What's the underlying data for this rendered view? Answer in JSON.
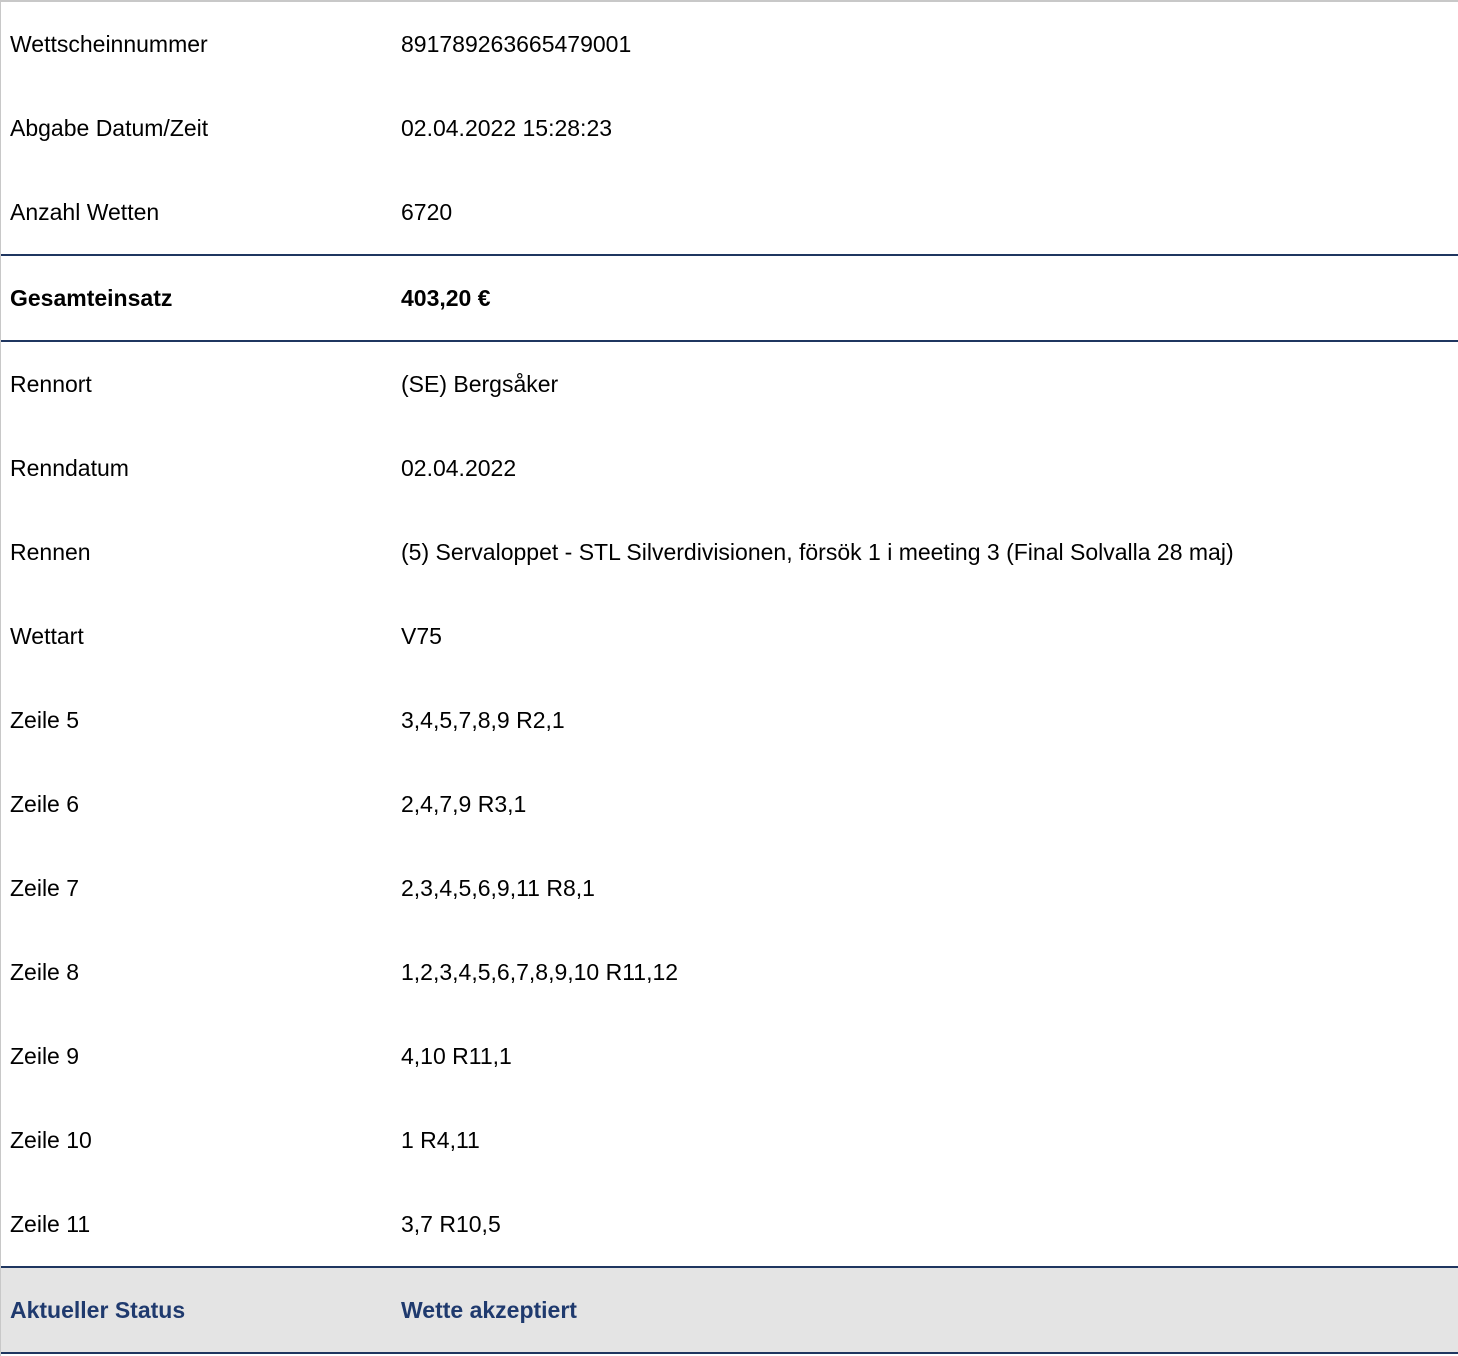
{
  "colors": {
    "separator": "#1f3660",
    "status_text": "#1f3a6e",
    "status_background": "#e4e4e4"
  },
  "info_rows": [
    {
      "label": "Wettscheinnummer",
      "value": "891789263665479001"
    },
    {
      "label": "Abgabe Datum/Zeit",
      "value": "02.04.2022 15:28:23"
    },
    {
      "label": "Anzahl Wetten",
      "value": "6720"
    }
  ],
  "total": {
    "label": "Gesamteinsatz",
    "value": "403,20 €"
  },
  "race_rows": [
    {
      "label": "Rennort",
      "value": "(SE) Bergsåker"
    },
    {
      "label": "Renndatum",
      "value": "02.04.2022"
    },
    {
      "label": "Rennen",
      "value": "(5) Servaloppet - STL Silverdivisionen, försök 1 i meeting 3 (Final Solvalla 28 maj)"
    },
    {
      "label": "Wettart",
      "value": "V75"
    },
    {
      "label": "Zeile 5",
      "value": "3,4,5,7,8,9 R2,1"
    },
    {
      "label": "Zeile 6",
      "value": "2,4,7,9 R3,1"
    },
    {
      "label": "Zeile 7",
      "value": "2,3,4,5,6,9,11 R8,1"
    },
    {
      "label": "Zeile 8",
      "value": "1,2,3,4,5,6,7,8,9,10 R11,12"
    },
    {
      "label": "Zeile 9",
      "value": "4,10 R11,1"
    },
    {
      "label": "Zeile 10",
      "value": "1 R4,11"
    },
    {
      "label": "Zeile 11",
      "value": "3,7 R10,5"
    }
  ],
  "status": {
    "label": "Aktueller Status",
    "value": "Wette akzeptiert"
  }
}
